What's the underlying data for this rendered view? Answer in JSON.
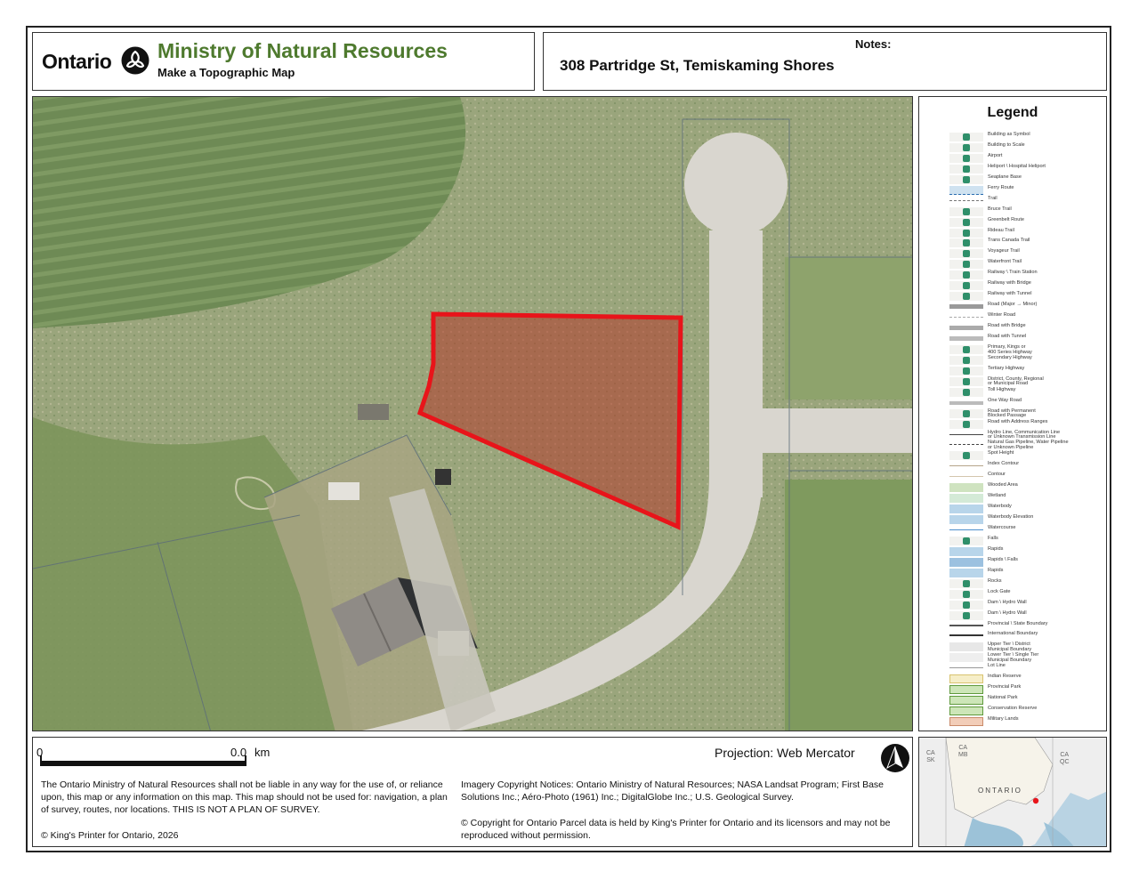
{
  "header": {
    "province": "Ontario",
    "ministry": "Ministry of Natural Resources",
    "subtitle": "Make a Topographic Map",
    "notes_label": "Notes:",
    "address": "308 Partridge St, Temiskaming Shores"
  },
  "colors": {
    "ministry_green": "#4e7a2e",
    "parcel_outline": "#e8141a",
    "parcel_fill": "#b23a2a",
    "road": "#d9d6cf"
  },
  "map": {
    "content": "aerial imagery with highlighted parcel",
    "highlighted_parcel": true
  },
  "legend": {
    "title": "Legend",
    "items": [
      {
        "label": "Building as Symbol",
        "icon": "building-symbol-icon"
      },
      {
        "label": "Building to Scale",
        "icon": "building-scale-icon"
      },
      {
        "label": "Airport",
        "icon": "airport-icon"
      },
      {
        "label": "Heliport \\ Hospital Heliport",
        "icon": "heliport-icon"
      },
      {
        "label": "Seaplane Base",
        "icon": "seaplane-icon"
      },
      {
        "label": "Ferry Route",
        "icon": "ferry-route-icon"
      },
      {
        "label": "Trail",
        "icon": "trail-icon"
      },
      {
        "label": "Bruce Trail",
        "icon": "bruce-trail-icon"
      },
      {
        "label": "Greenbelt Route",
        "icon": "greenbelt-route-icon"
      },
      {
        "label": "Rideau Trail",
        "icon": "rideau-trail-icon"
      },
      {
        "label": "Trans Canada Trail",
        "icon": "trans-canada-trail-icon"
      },
      {
        "label": "Voyageur Trail",
        "icon": "voyageur-trail-icon"
      },
      {
        "label": "Waterfront Trail",
        "icon": "waterfront-trail-icon"
      },
      {
        "label": "Railway \\ Train Station",
        "icon": "railway-station-icon"
      },
      {
        "label": "Railway with Bridge",
        "icon": "railway-bridge-icon"
      },
      {
        "label": "Railway with Tunnel",
        "icon": "railway-tunnel-icon"
      },
      {
        "label": "Road (Major → Minor)",
        "icon": "road-icon"
      },
      {
        "label": "Winter Road",
        "icon": "winter-road-icon"
      },
      {
        "label": "Road with Bridge",
        "icon": "road-bridge-icon"
      },
      {
        "label": "Road with Tunnel",
        "icon": "road-tunnel-icon"
      },
      {
        "label": "Primary, Kings or\n400 Series Highway",
        "icon": "primary-highway-icon"
      },
      {
        "label": "Secondary Highway",
        "icon": "secondary-highway-icon"
      },
      {
        "label": "Tertiary Highway",
        "icon": "tertiary-highway-icon"
      },
      {
        "label": "District, County, Regional\nor Municipal Road",
        "icon": "municipal-road-icon"
      },
      {
        "label": "Toll Highway",
        "icon": "toll-highway-icon"
      },
      {
        "label": "One Way Road",
        "icon": "one-way-road-icon"
      },
      {
        "label": "Road with Permanent\nBlocked Passage",
        "icon": "blocked-road-icon"
      },
      {
        "label": "Road with Address Ranges",
        "icon": "address-range-icon"
      },
      {
        "label": "Hydro Line, Communication Line\nor Unknown Transmission Line",
        "icon": "hydro-line-icon"
      },
      {
        "label": "Natural Gas Pipeline, Water Pipeline\nor Unknown Pipeline",
        "icon": "pipeline-icon"
      },
      {
        "label": "Spot Height",
        "icon": "spot-height-icon"
      },
      {
        "label": "Index Contour",
        "icon": "index-contour-icon"
      },
      {
        "label": "Contour",
        "icon": "contour-icon"
      },
      {
        "label": "Wooded Area",
        "icon": "wooded-area-icon"
      },
      {
        "label": "Wetland",
        "icon": "wetland-icon"
      },
      {
        "label": "Waterbody",
        "icon": "waterbody-icon"
      },
      {
        "label": "Waterbody Elevation",
        "icon": "waterbody-elevation-icon"
      },
      {
        "label": "Watercourse",
        "icon": "watercourse-icon"
      },
      {
        "label": "Falls",
        "icon": "falls-icon"
      },
      {
        "label": "Rapids",
        "icon": "rapids-icon"
      },
      {
        "label": "Rapids \\ Falls",
        "icon": "rapids-falls-icon"
      },
      {
        "label": "Rapids",
        "icon": "rapids-icon"
      },
      {
        "label": "Rocks",
        "icon": "rocks-icon"
      },
      {
        "label": "Lock Gate",
        "icon": "lock-gate-icon"
      },
      {
        "label": "Dam \\ Hydro Wall",
        "icon": "dam-icon"
      },
      {
        "label": "Dam \\ Hydro Wall",
        "icon": "dam-line-icon"
      },
      {
        "label": "Provincial \\ State Boundary",
        "icon": "provincial-boundary-icon"
      },
      {
        "label": "International Boundary",
        "icon": "international-boundary-icon"
      },
      {
        "label": "Upper Tier \\ District\nMunicipal Boundary",
        "icon": "upper-tier-boundary-icon"
      },
      {
        "label": "Lower Tier \\ Single Tier\nMunicipal Boundary",
        "icon": "lower-tier-boundary-icon"
      },
      {
        "label": "Lot Line",
        "icon": "lot-line-icon"
      },
      {
        "label": "Indian Reserve",
        "icon": "indian-reserve-icon"
      },
      {
        "label": "Provincial Park",
        "icon": "provincial-park-icon"
      },
      {
        "label": "National Park",
        "icon": "national-park-icon"
      },
      {
        "label": "Conservation Reserve",
        "icon": "conservation-reserve-icon"
      },
      {
        "label": "Military Lands",
        "icon": "military-lands-icon"
      }
    ]
  },
  "scale": {
    "start": "0",
    "end": "0.0",
    "unit": "km"
  },
  "projection": "Projection: Web Mercator",
  "disclaimer": "The Ontario Ministry of Natural Resources shall not be liable in any way for the use of, or reliance upon, this map or any information on this map.  This map should not be used for: navigation, a plan of survey, routes, nor locations. THIS IS NOT A PLAN OF SURVEY.",
  "copyright": "© King's Printer for Ontario,  2026",
  "imagery_notice": "Imagery Copyright Notices: Ontario Ministry of Natural Resources; NASA Landsat Program; First Base Solutions Inc.; Aéro-Photo (1961) Inc.; DigitalGlobe Inc.; U.S. Geological Survey.",
  "parcel_notice": "© Copyright for Ontario Parcel data is held by King's Printer for Ontario and its licensors and may not be reproduced without permission.",
  "inset": {
    "labels": {
      "ca_sk": "CA\nSK",
      "ca_mb": "CA\nMB",
      "ca_qc": "CA\nQC"
    },
    "province_label": "ONTARIO"
  }
}
